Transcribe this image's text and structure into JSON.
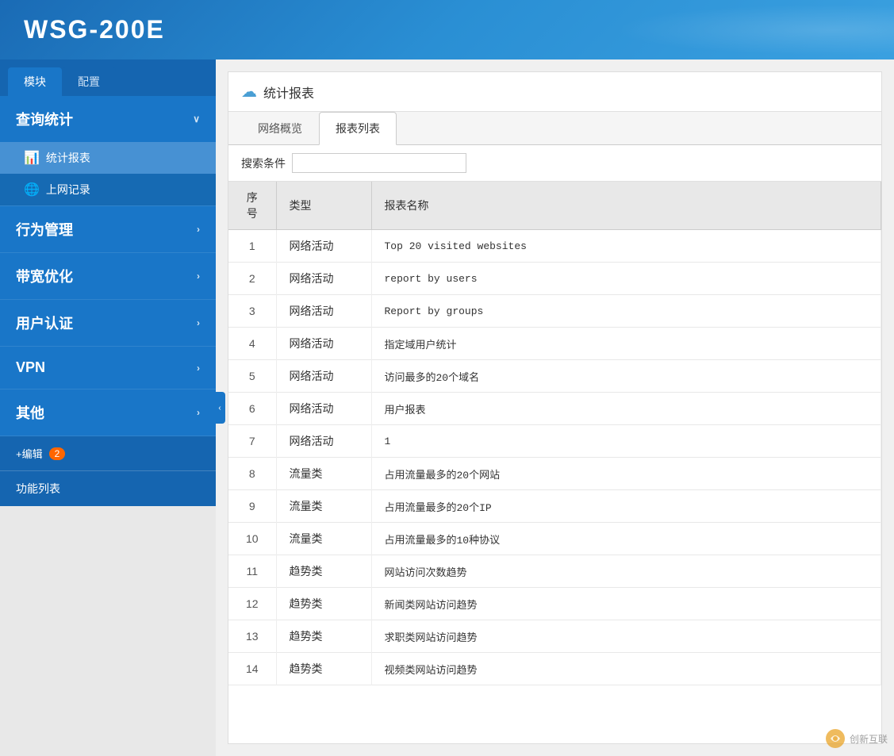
{
  "header": {
    "title": "WSG-200E"
  },
  "sidebar": {
    "tab_module": "模块",
    "tab_config": "配置",
    "sections": [
      {
        "id": "query-stats",
        "label": "查询统计",
        "has_arrow": true,
        "arrow": "∨",
        "expanded": true,
        "sub_items": [
          {
            "id": "stats-report",
            "icon": "📊",
            "label": "统计报表"
          },
          {
            "id": "internet-log",
            "icon": "🌐",
            "label": "上网记录"
          }
        ]
      },
      {
        "id": "behavior-mgmt",
        "label": "行为管理",
        "has_arrow": true,
        "arrow": "›"
      },
      {
        "id": "bandwidth-opt",
        "label": "带宽优化",
        "has_arrow": true,
        "arrow": "›"
      },
      {
        "id": "user-auth",
        "label": "用户认证",
        "has_arrow": true,
        "arrow": "›"
      },
      {
        "id": "vpn",
        "label": "VPN",
        "has_arrow": true,
        "arrow": "›"
      },
      {
        "id": "other",
        "label": "其他",
        "has_arrow": true,
        "arrow": "›"
      }
    ],
    "edit_label": "+编辑",
    "edit_badge": "2",
    "func_list_label": "功能列表"
  },
  "content": {
    "header_title": "统计报表",
    "tabs": [
      {
        "id": "network-overview",
        "label": "网络概览"
      },
      {
        "id": "report-list",
        "label": "报表列表",
        "active": true
      }
    ],
    "search": {
      "label": "搜索条件",
      "placeholder": ""
    },
    "table": {
      "columns": [
        "序号",
        "类型",
        "报表名称"
      ],
      "rows": [
        {
          "no": 1,
          "type": "网络活动",
          "name": "Top  20  visited  websites"
        },
        {
          "no": 2,
          "type": "网络活动",
          "name": "report  by  users"
        },
        {
          "no": 3,
          "type": "网络活动",
          "name": "Report  by  groups"
        },
        {
          "no": 4,
          "type": "网络活动",
          "name": "指定域用户统计"
        },
        {
          "no": 5,
          "type": "网络活动",
          "name": "访问最多的20个域名"
        },
        {
          "no": 6,
          "type": "网络活动",
          "name": "用户报表"
        },
        {
          "no": 7,
          "type": "网络活动",
          "name": "1"
        },
        {
          "no": 8,
          "type": "流量类",
          "name": "占用流量最多的20个网站"
        },
        {
          "no": 9,
          "type": "流量类",
          "name": "占用流量最多的20个IP"
        },
        {
          "no": 10,
          "type": "流量类",
          "name": "占用流量最多的10种协议"
        },
        {
          "no": 11,
          "type": "趋势类",
          "name": "网站访问次数趋势"
        },
        {
          "no": 12,
          "type": "趋势类",
          "name": "新闻类网站访问趋势"
        },
        {
          "no": 13,
          "type": "趋势类",
          "name": "求职类网站访问趋势"
        },
        {
          "no": 14,
          "type": "趋势类",
          "name": "视频类网站访问趋势"
        }
      ]
    }
  },
  "logo": {
    "text": "创新互联"
  }
}
